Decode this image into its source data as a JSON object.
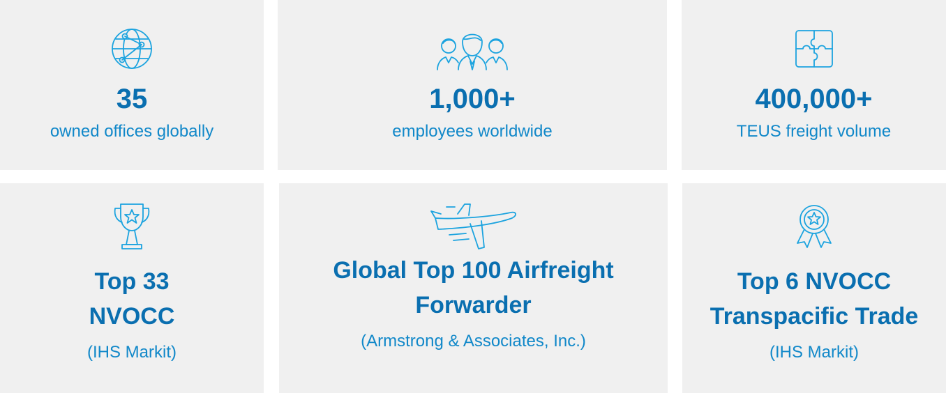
{
  "stats": [
    {
      "value": "35",
      "caption": "owned offices globally",
      "icon": "globe-network-icon"
    },
    {
      "value": "1,000+",
      "caption": "employees worldwide",
      "icon": "team-people-icon"
    },
    {
      "value": "400,000+",
      "caption": "TEUS freight volume",
      "icon": "puzzle-piece-icon"
    }
  ],
  "rankings": [
    {
      "title_line1": "Top 33",
      "title_line2": "NVOCC",
      "source": "(IHS Markit)",
      "icon": "trophy-icon"
    },
    {
      "title_line1": "Global Top 100 Airfreight",
      "title_line2": "Forwarder",
      "source": "(Armstrong & Associates, Inc.)",
      "icon": "airplane-icon"
    },
    {
      "title_line1": "Top 6 NVOCC",
      "title_line2": "Transpacific Trade",
      "source": "(IHS Markit)",
      "icon": "award-ribbon-icon"
    }
  ],
  "colors": {
    "card_bg": "#f0f0f0",
    "heading": "#0a6fb0",
    "caption": "#1188c9",
    "icon_stroke": "#1ba3df"
  }
}
